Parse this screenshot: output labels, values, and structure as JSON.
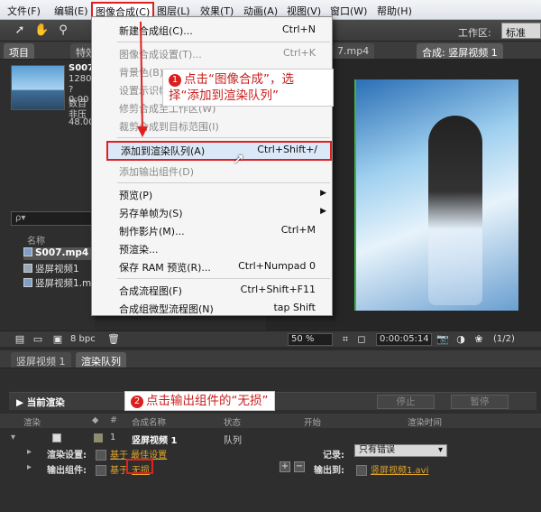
{
  "menubar": {
    "items": [
      "文件(F)",
      "编辑(E)",
      "图像合成(C)",
      "图层(L)",
      "效果(T)",
      "动画(A)",
      "视图(V)",
      "窗口(W)",
      "帮助(H)"
    ]
  },
  "toolbar": {
    "workspace_label": "工作区:",
    "workspace_value": "标准"
  },
  "tabs": {
    "project": "项目",
    "effects": "特效",
    "footage": "7.mp4",
    "composition": "合成: 竖屏视频 1"
  },
  "project": {
    "file_name": "S007",
    "file_res": "1280",
    "file_dur": "? 0:00",
    "file_audio": "数百",
    "file_comp": "非压",
    "file_fps": "48.00",
    "search_placeholder": "ρ▾",
    "col_name": "名称",
    "items": [
      "S007.mp4",
      "竖屏视频1",
      "竖屏视频1.m"
    ],
    "bpc": "8 bpc"
  },
  "viewer": {
    "zoom": "50 %",
    "timecode": "0:00:05:14",
    "resolution": "(1/2)"
  },
  "menu": {
    "items": [
      {
        "label": "新建合成组(C)...",
        "shortcut": "Ctrl+N",
        "disabled": false
      },
      {
        "label": "图像合成设置(T)...",
        "shortcut": "Ctrl+K",
        "disabled": true
      },
      {
        "label": "背景色(B)...",
        "shortcut": "",
        "disabled": true
      },
      {
        "label": "设置示识帧(E)",
        "shortcut": "",
        "disabled": true
      },
      {
        "label": "修剪合成至工作区(W)",
        "shortcut": "",
        "disabled": true
      },
      {
        "label": "裁剪合成到目标范围(I)",
        "shortcut": "",
        "disabled": true
      },
      {
        "label": "添加到渲染队列(A)",
        "shortcut": "Ctrl+Shift+/",
        "disabled": false
      },
      {
        "label": "添加输出组件(D)",
        "shortcut": "",
        "disabled": true
      },
      {
        "label": "预览(P)",
        "shortcut": "",
        "disabled": false
      },
      {
        "label": "另存单帧为(S)",
        "shortcut": "",
        "disabled": false
      },
      {
        "label": "制作影片(M)...",
        "shortcut": "Ctrl+M",
        "disabled": false
      },
      {
        "label": "预渲染...",
        "shortcut": "",
        "disabled": false
      },
      {
        "label": "保存 RAM 预览(R)...",
        "shortcut": "Ctrl+Numpad 0",
        "disabled": false
      },
      {
        "label": "合成流程图(F)",
        "shortcut": "Ctrl+Shift+F11",
        "disabled": false
      },
      {
        "label": "合成组微型流程图(N)",
        "shortcut": "tap Shift",
        "disabled": false
      }
    ]
  },
  "callouts": {
    "one_num": "1",
    "one_text_a": "点击“图像合成”，选",
    "one_text_b": "择“添加到渲染队列”",
    "two_num": "2",
    "two_text": "点击输出组件的“无损”"
  },
  "render_queue": {
    "tab_comp": "竖屏视频 1",
    "tab_queue": "渲染队列",
    "current_render": "当前渲染",
    "btn_stop": "停止",
    "btn_pause": "暂停",
    "headers": {
      "render": "渲染",
      "tag": "",
      "num": "#",
      "comp_name": "合成名称",
      "status": "状态",
      "start": "开始",
      "render_time": "渲染时间"
    },
    "row_num": "1",
    "row_comp": "竖屏视频 1",
    "row_status": "队列",
    "render_settings_label": "渲染设置:",
    "render_settings_value": "基于 最佳设置",
    "output_module_label": "输出组件:",
    "output_prefix": "基于",
    "output_value": "无损",
    "log_label": "记录:",
    "log_value": "只有错误",
    "output_to_label": "输出到:",
    "output_to_value": "竖屏视频1.avi"
  }
}
